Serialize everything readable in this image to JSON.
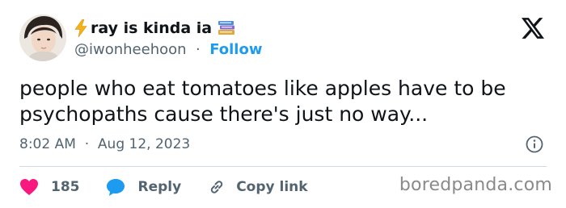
{
  "author": {
    "display_name": "ray is kinda ia",
    "handle": "@iwonheehoon",
    "separator": "·",
    "follow_label": "Follow",
    "name_emoji_left": "lightning-icon",
    "name_emoji_right": "books-icon"
  },
  "tweet": {
    "text": "people who eat tomatoes like apples have to be psychopaths cause there's just no way...",
    "time": "8:02 AM",
    "separator": "·",
    "date": "Aug 12, 2023"
  },
  "actions": {
    "like_count": "185",
    "reply_label": "Reply",
    "copy_link_label": "Copy link"
  },
  "watermark": "boredpanda.com",
  "colors": {
    "accent": "#1d9bf0",
    "like": "#f91880",
    "text_primary": "#0f1419",
    "text_secondary": "#536471"
  }
}
